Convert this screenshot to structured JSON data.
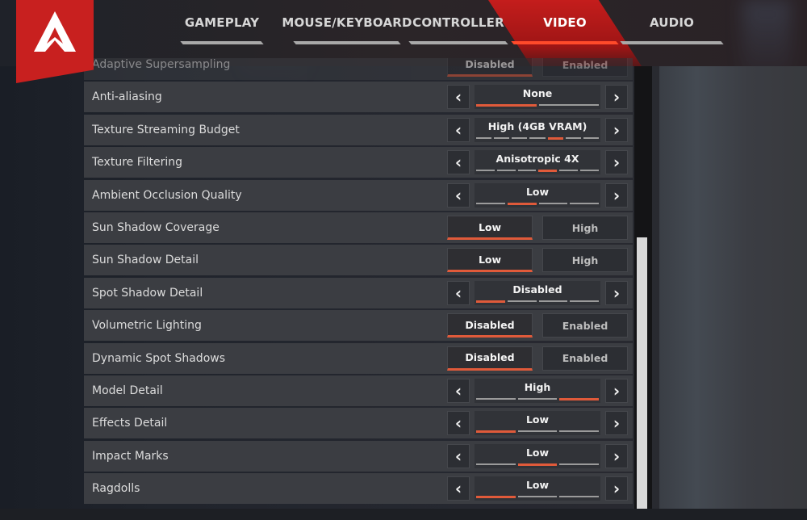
{
  "brand": {
    "logo_icon": "apex-logo-icon",
    "accent_color": "#c8201f",
    "highlight_color": "#e05a3a"
  },
  "tabs": [
    {
      "label": "GAMEPLAY",
      "active": false
    },
    {
      "label": "MOUSE/KEYBOARD",
      "active": false
    },
    {
      "label": "CONTROLLER",
      "active": false
    },
    {
      "label": "VIDEO",
      "active": true
    },
    {
      "label": "AUDIO",
      "active": false
    }
  ],
  "settings": [
    {
      "label": "Adaptive Supersampling",
      "type": "toggle",
      "options": [
        "Disabled",
        "Enabled"
      ],
      "selected": 0,
      "clipped": true
    },
    {
      "label": "Anti-aliasing",
      "type": "selector",
      "value": "None",
      "steps": 2,
      "index": 0
    },
    {
      "label": "Texture Streaming Budget",
      "type": "selector",
      "value": "High (4GB VRAM)",
      "steps": 7,
      "index": 4
    },
    {
      "label": "Texture Filtering",
      "type": "selector",
      "value": "Anisotropic 4X",
      "steps": 6,
      "index": 3
    },
    {
      "label": "Ambient Occlusion Quality",
      "type": "selector",
      "value": "Low",
      "steps": 4,
      "index": 1
    },
    {
      "label": "Sun Shadow Coverage",
      "type": "toggle",
      "options": [
        "Low",
        "High"
      ],
      "selected": 0
    },
    {
      "label": "Sun Shadow Detail",
      "type": "toggle",
      "options": [
        "Low",
        "High"
      ],
      "selected": 0
    },
    {
      "label": "Spot Shadow Detail",
      "type": "selector",
      "value": "Disabled",
      "steps": 4,
      "index": 0
    },
    {
      "label": "Volumetric Lighting",
      "type": "toggle",
      "options": [
        "Disabled",
        "Enabled"
      ],
      "selected": 0
    },
    {
      "label": "Dynamic Spot Shadows",
      "type": "toggle",
      "options": [
        "Disabled",
        "Enabled"
      ],
      "selected": 0
    },
    {
      "label": "Model Detail",
      "type": "selector",
      "value": "High",
      "steps": 3,
      "index": 2
    },
    {
      "label": "Effects Detail",
      "type": "selector",
      "value": "Low",
      "steps": 3,
      "index": 0
    },
    {
      "label": "Impact Marks",
      "type": "selector",
      "value": "Low",
      "steps": 3,
      "index": 1
    },
    {
      "label": "Ragdolls",
      "type": "selector",
      "value": "Low",
      "steps": 3,
      "index": 0
    }
  ],
  "icons": {
    "prev": "‹",
    "next": "›"
  },
  "scrollbar": {
    "position_fraction": 0.4
  }
}
